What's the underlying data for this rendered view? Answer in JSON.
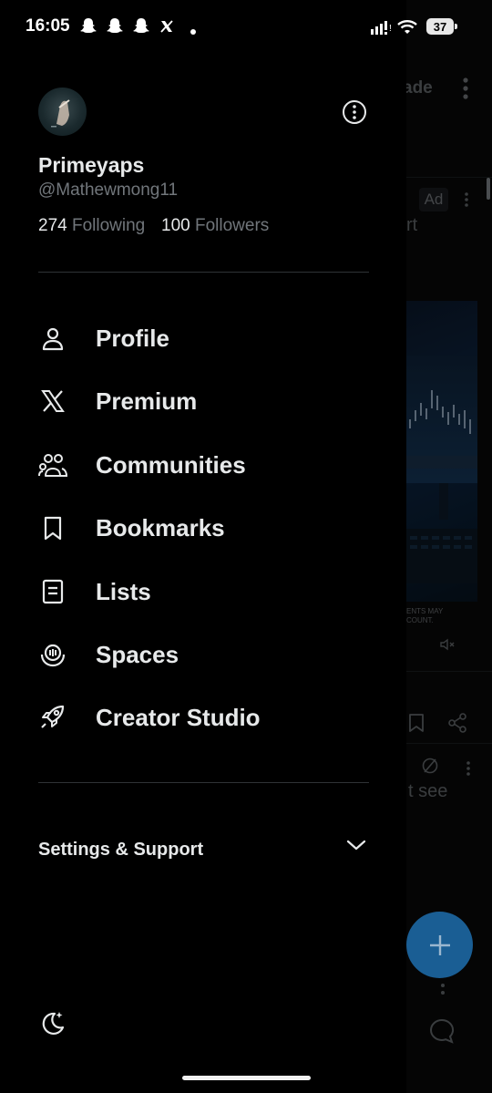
{
  "status_bar": {
    "time": "16:05",
    "notification_icons": [
      "snapchat-icon",
      "snapchat-icon",
      "snapchat-icon",
      "x-icon",
      "dot-icon"
    ],
    "battery": "37"
  },
  "drawer": {
    "more_icon": "more-circle-icon",
    "profile": {
      "display_name": "Primeyaps",
      "handle": "@Mathewmong11",
      "following_count": "274",
      "following_label": "Following",
      "followers_count": "100",
      "followers_label": "Followers"
    },
    "menu": [
      {
        "label": "Profile",
        "icon": "person-icon"
      },
      {
        "label": "Premium",
        "icon": "x-logo-icon"
      },
      {
        "label": "Communities",
        "icon": "communities-icon"
      },
      {
        "label": "Bookmarks",
        "icon": "bookmark-icon"
      },
      {
        "label": "Lists",
        "icon": "list-icon"
      },
      {
        "label": "Spaces",
        "icon": "spaces-icon"
      },
      {
        "label": "Creator Studio",
        "icon": "rocket-icon"
      }
    ],
    "settings_label": "Settings & Support",
    "theme_icon": "moon-stars-icon"
  },
  "background_feed": {
    "header_text": "ade",
    "ad_badge": "Ad",
    "post_text_1": "rt",
    "disclaimer_line_1": "ENTS MAY",
    "disclaimer_line_2": "COUNT.",
    "post_text_2": "t see"
  },
  "colors": {
    "background": "#000000",
    "text_primary": "#e7e9ea",
    "text_secondary": "#71767b",
    "divider": "#2f3336",
    "fab": "#1a5e94"
  }
}
